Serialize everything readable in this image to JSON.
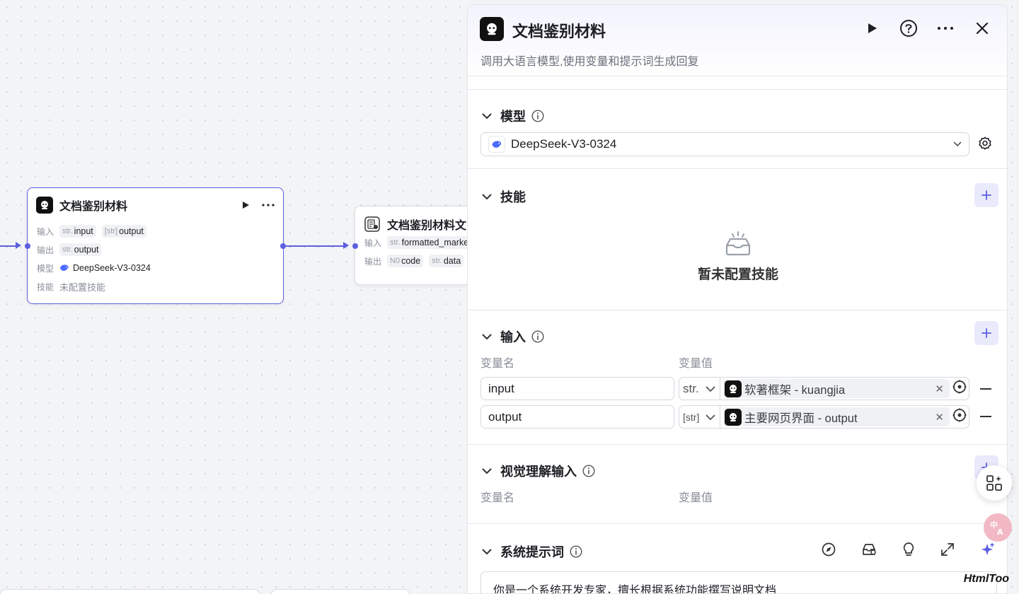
{
  "canvas": {
    "node_main": {
      "title": "文档鉴别材料",
      "rows": {
        "input_label": "输入",
        "inputs": [
          {
            "type": "str.",
            "name": "input"
          },
          {
            "type": "[str]",
            "name": "output"
          }
        ],
        "output_label": "输出",
        "outputs": [
          {
            "type": "str.",
            "name": "output"
          }
        ],
        "model_label": "模型",
        "model": "DeepSeek-V3-0324",
        "skill_label": "技能",
        "skill_value": "未配置技能"
      }
    },
    "node_next": {
      "title": "文档鉴别材料文",
      "input_label": "输入",
      "input": {
        "type": "str.",
        "name": "formatted_marke"
      },
      "output_label": "输出",
      "outputs": [
        {
          "type": "N0",
          "name": "code"
        },
        {
          "type": "str.",
          "name": "data"
        }
      ]
    }
  },
  "panel": {
    "title": "文档鉴别材料",
    "description": "调用大语言模型,使用变量和提示词生成回复",
    "model_section": {
      "title": "模型",
      "selected": "DeepSeek-V3-0324"
    },
    "skill_section": {
      "title": "技能",
      "empty_text": "暂未配置技能"
    },
    "input_section": {
      "title": "输入",
      "col_name": "变量名",
      "col_value": "变量值",
      "rows": [
        {
          "name": "input",
          "type": "str.",
          "ref": "软著框架 - kuangjia"
        },
        {
          "name": "output",
          "type": "[str]",
          "ref": "主要网页界面 - output"
        }
      ]
    },
    "vision_section": {
      "title": "视觉理解输入",
      "col_name": "变量名",
      "col_value": "变量值"
    },
    "system_prompt_section": {
      "title": "系统提示词",
      "content": "你是一个系统开发专家，擅长根据系统功能撰写说明文档"
    }
  },
  "watermark": "HtmlToo",
  "colors": {
    "accent": "#5b5fe0",
    "accent_soft": "#e9eafc"
  }
}
